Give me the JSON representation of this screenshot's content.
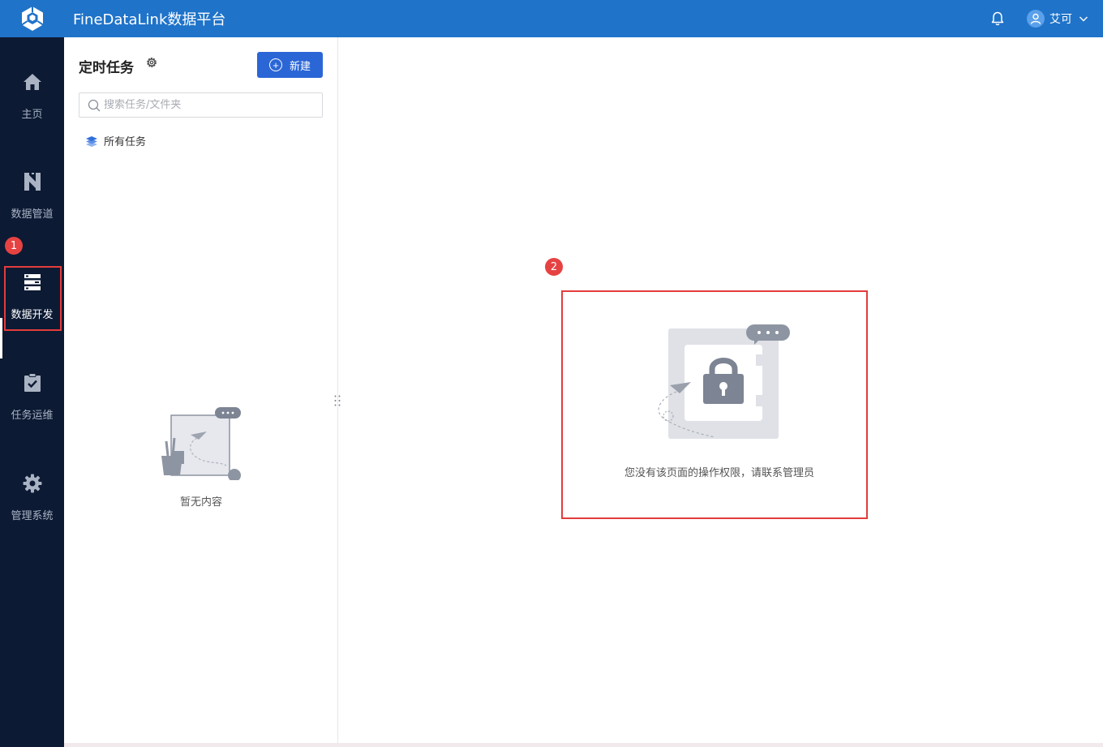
{
  "header": {
    "app_title": "FineDataLink数据平台",
    "user_name": "艾可",
    "icons": [
      "app-logo-icon",
      "bell-icon",
      "user-avatar-icon",
      "chevron-down-icon"
    ],
    "color": "#1f73c9"
  },
  "sidebar": {
    "items": [
      {
        "label": "主页",
        "icon": "home-icon"
      },
      {
        "label": "数据管道",
        "icon": "pipeline-icon"
      },
      {
        "label": "数据开发",
        "icon": "server-icon",
        "active": true
      },
      {
        "label": "任务运维",
        "icon": "clipboard-check-icon"
      },
      {
        "label": "管理系统",
        "icon": "gear-icon"
      }
    ],
    "badge": "1",
    "color": "#0c1a33"
  },
  "panel": {
    "title": "定时任务",
    "new_button": "新建",
    "search_placeholder": "搜索任务/文件夹",
    "all_tasks": "所有任务",
    "empty_text": "暂无内容"
  },
  "main": {
    "badge": "2",
    "permission_text": "您没有该页面的操作权限，请联系管理员"
  },
  "highlight_color": "#e33c3c"
}
